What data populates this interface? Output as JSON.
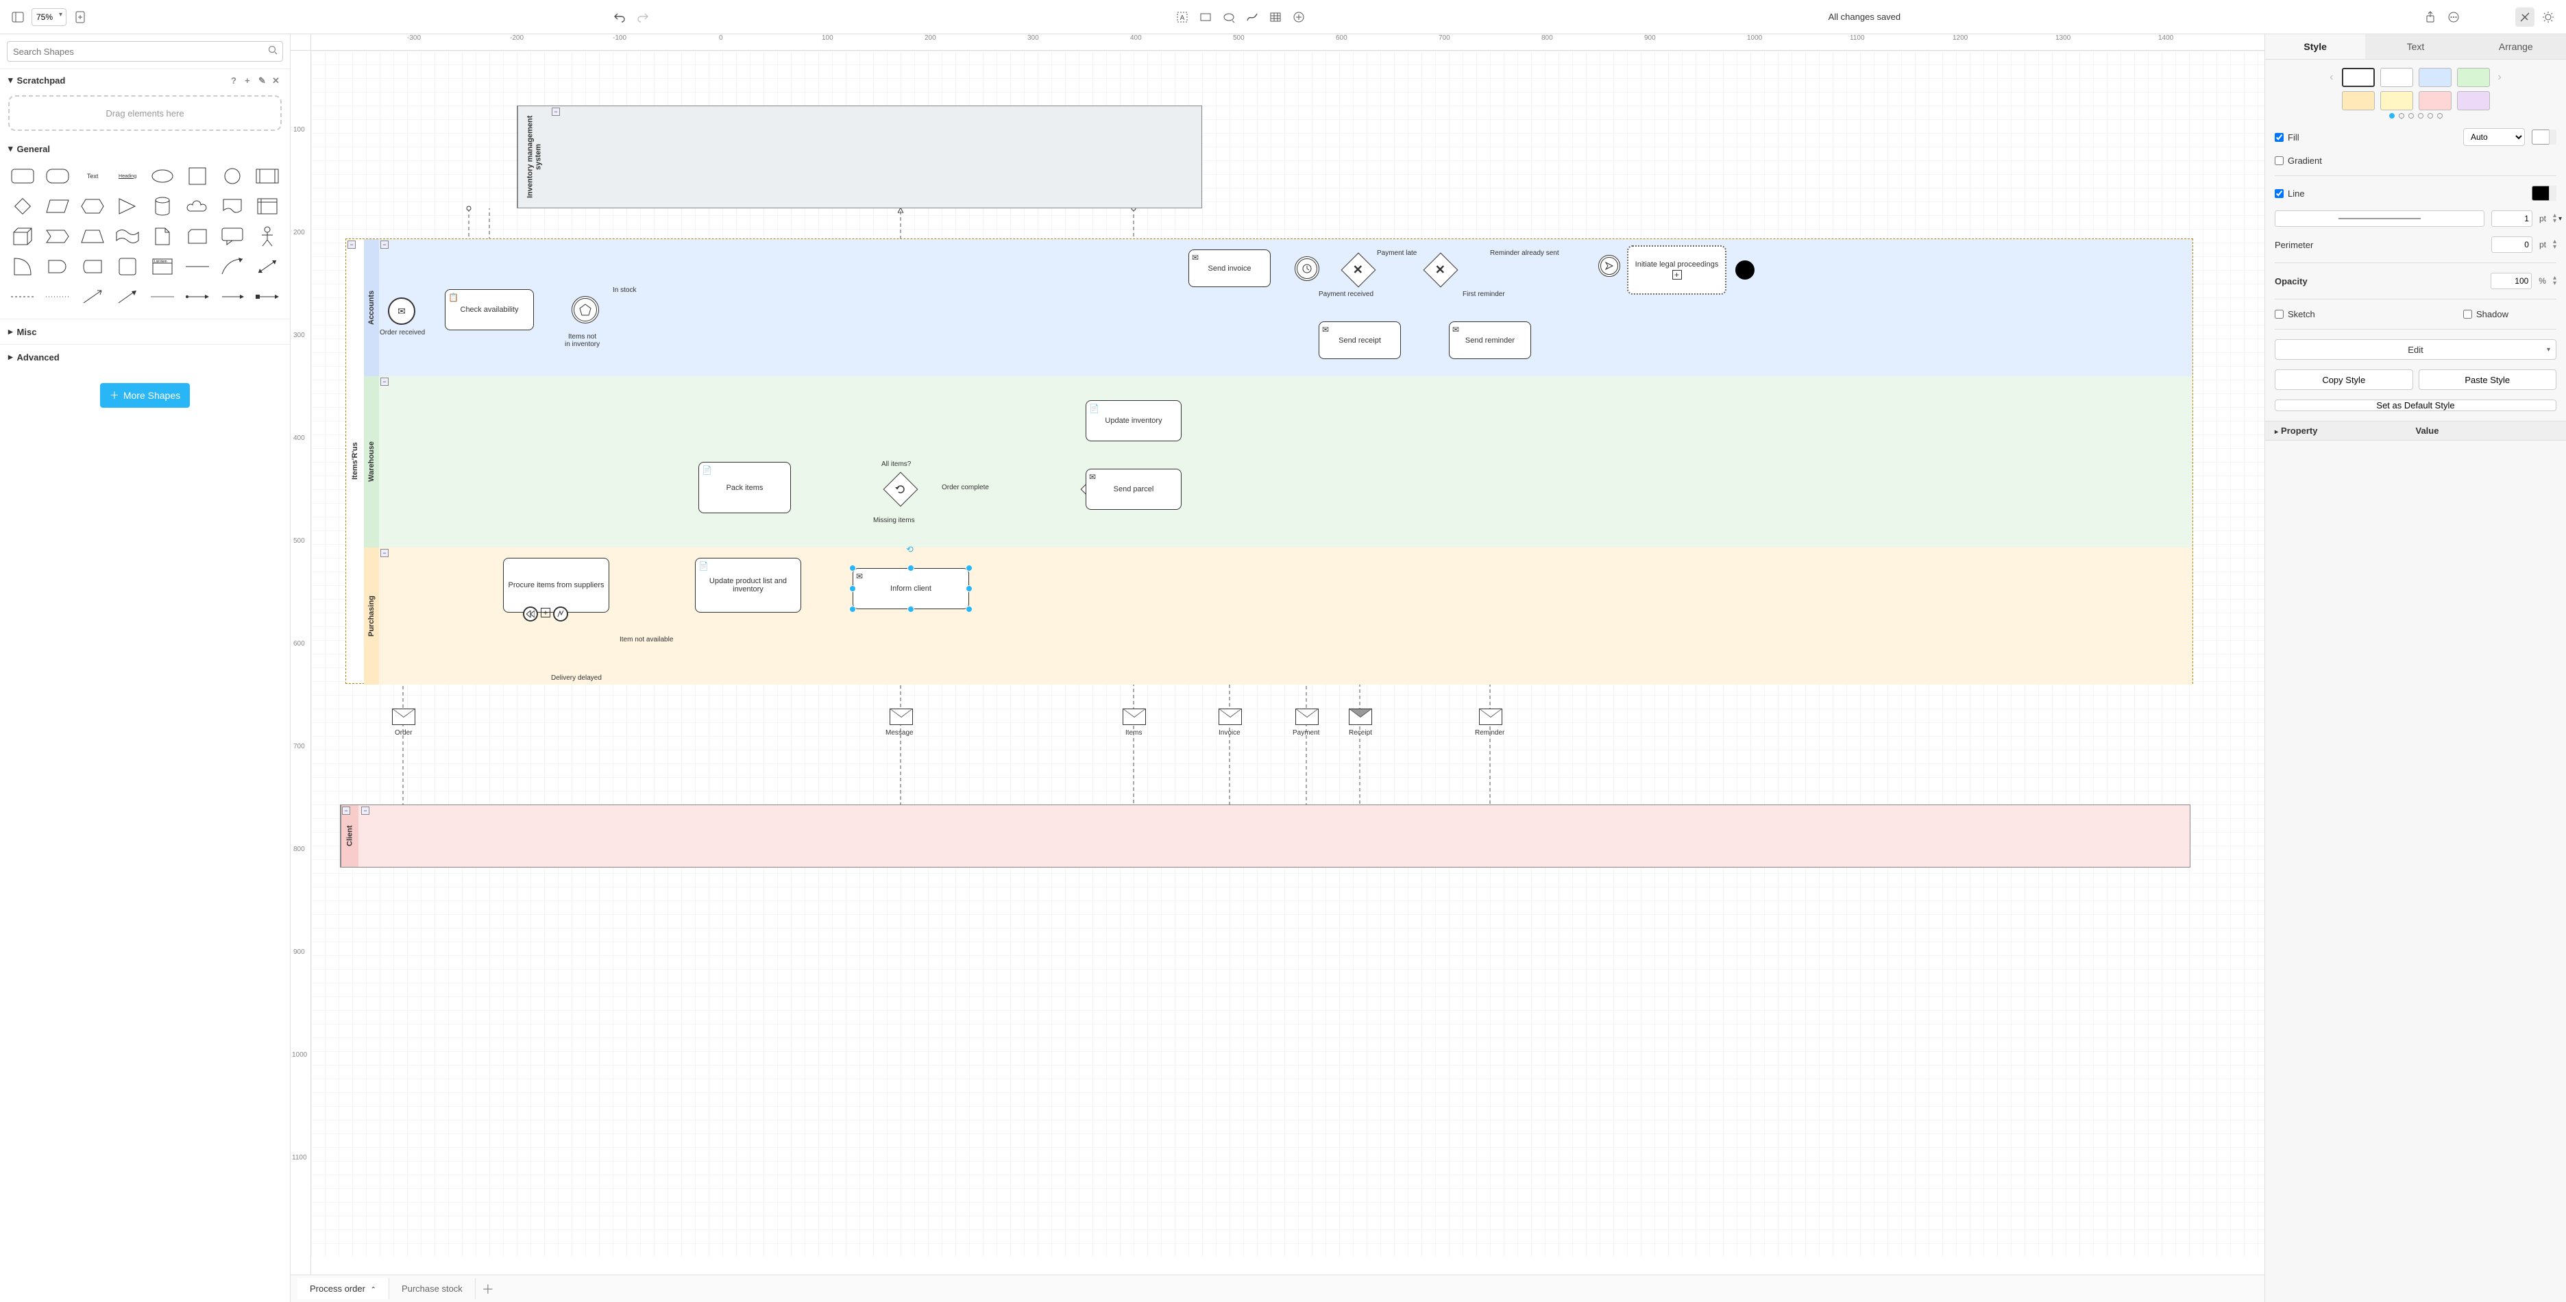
{
  "toolbar": {
    "zoom": "75%",
    "status": "All changes saved"
  },
  "left": {
    "search_placeholder": "Search Shapes",
    "scratchpad_title": "Scratchpad",
    "drag_hint": "Drag elements here",
    "general_title": "General",
    "misc_title": "Misc",
    "advanced_title": "Advanced",
    "more_shapes": "More Shapes",
    "shape_text_label": "Text",
    "shape_heading_label": "Heading",
    "shape_listitem_label": "List item"
  },
  "ruler_h": [
    "-300",
    "-200",
    "-100",
    "0",
    "100",
    "200",
    "300",
    "400",
    "500",
    "600",
    "700",
    "800",
    "900",
    "1000",
    "1100",
    "1200",
    "1300",
    "1400"
  ],
  "ruler_v": [
    "100",
    "200",
    "300",
    "400",
    "500",
    "600",
    "700",
    "800",
    "900",
    "1000",
    "1100"
  ],
  "tabs": {
    "active": "Process order",
    "others": [
      "Purchase stock"
    ]
  },
  "right": {
    "tabs": [
      "Style",
      "Text",
      "Arrange"
    ],
    "fill_label": "Fill",
    "fill_mode": "Auto",
    "gradient_label": "Gradient",
    "line_label": "Line",
    "line_width": "1",
    "line_unit": "pt",
    "perimeter_label": "Perimeter",
    "perimeter_value": "0",
    "perimeter_unit": "pt",
    "opacity_label": "Opacity",
    "opacity_value": "100",
    "opacity_unit": "%",
    "sketch_label": "Sketch",
    "shadow_label": "Shadow",
    "edit_label": "Edit",
    "copy_style": "Copy Style",
    "paste_style": "Paste Style",
    "set_default": "Set as Default Style",
    "property_hdr": "Property",
    "value_hdr": "Value",
    "swatches_row1": [
      "#ffffff",
      "#ffffff",
      "#d6e8ff",
      "#d8f5d3"
    ],
    "swatches_row2": [
      "#ffe9b8",
      "#fff6c4",
      "#ffd6d6",
      "#ecd9f7"
    ]
  },
  "diagram": {
    "pool1": {
      "title": "Inventory management system"
    },
    "pool2": {
      "title": "Items'R'us",
      "lanes": [
        "Accounts",
        "Warehouse",
        "Purchasing"
      ]
    },
    "pool3": {
      "title": "Client"
    },
    "tasks": {
      "check_availability": "Check availability",
      "pack_items": "Pack items",
      "update_inventory": "Update inventory",
      "send_parcel": "Send parcel",
      "procure": "Procure items from suppliers",
      "update_product_list": "Update product list and inventory",
      "inform_client": "Inform client",
      "send_invoice": "Send invoice",
      "send_receipt": "Send receipt",
      "send_reminder": "Send reminder",
      "initiate_legal": "Initiate legal proceedings"
    },
    "labels": {
      "order_received": "Order received",
      "in_stock": "In stock",
      "items_not_inventory": "Items not\nin inventory",
      "all_items_q": "All items?",
      "order_complete": "Order complete",
      "missing_items": "Missing items",
      "item_not_available": "Item not available",
      "delivery_delayed": "Delivery delayed",
      "payment_late": "Payment late",
      "payment_received": "Payment received",
      "first_reminder": "First reminder",
      "reminder_already_sent": "Reminder already sent"
    },
    "message_flows": [
      "Order",
      "Message",
      "Items",
      "Invoice",
      "Payment",
      "Receipt",
      "Reminder"
    ]
  }
}
